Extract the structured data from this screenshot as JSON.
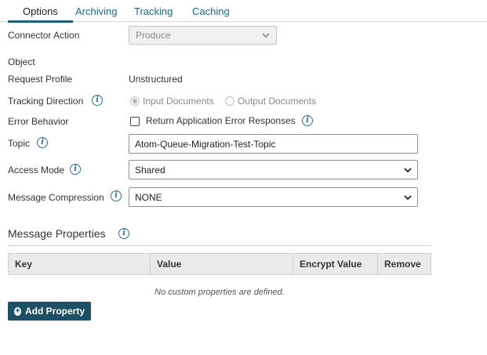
{
  "tabs": [
    {
      "label": "Options"
    },
    {
      "label": "Archiving"
    },
    {
      "label": "Tracking"
    },
    {
      "label": "Caching"
    }
  ],
  "form": {
    "connector_action": {
      "label": "Connector Action",
      "value": "Produce"
    },
    "object": {
      "label": "Object"
    },
    "request_profile": {
      "label": "Request Profile",
      "value": "Unstructured"
    },
    "tracking_direction": {
      "label": "Tracking Direction",
      "option_input": "Input Documents",
      "option_output": "Output Documents",
      "selected": "Input Documents"
    },
    "error_behavior": {
      "label": "Error Behavior",
      "checkbox_label": "Return Application Error Responses",
      "checked": false
    },
    "topic": {
      "label": "Topic",
      "value": "Atom-Queue-Migration-Test-Topic"
    },
    "access_mode": {
      "label": "Access Mode",
      "value": "Shared"
    },
    "message_compression": {
      "label": "Message Compression",
      "value": "NONE"
    }
  },
  "message_properties": {
    "title": "Message Properties",
    "columns": [
      "Key",
      "Value",
      "Encrypt Value",
      "Remove"
    ],
    "empty_message": "No custom properties are defined.",
    "add_button": "Add Property"
  },
  "icons": {
    "info": "i",
    "plus": "+"
  },
  "colors": {
    "tab_link": "#1b6c88",
    "active_tab_underline": "#1f5f78",
    "info_icon": "#2d6fa3",
    "primary_button": "#1d4f66"
  }
}
